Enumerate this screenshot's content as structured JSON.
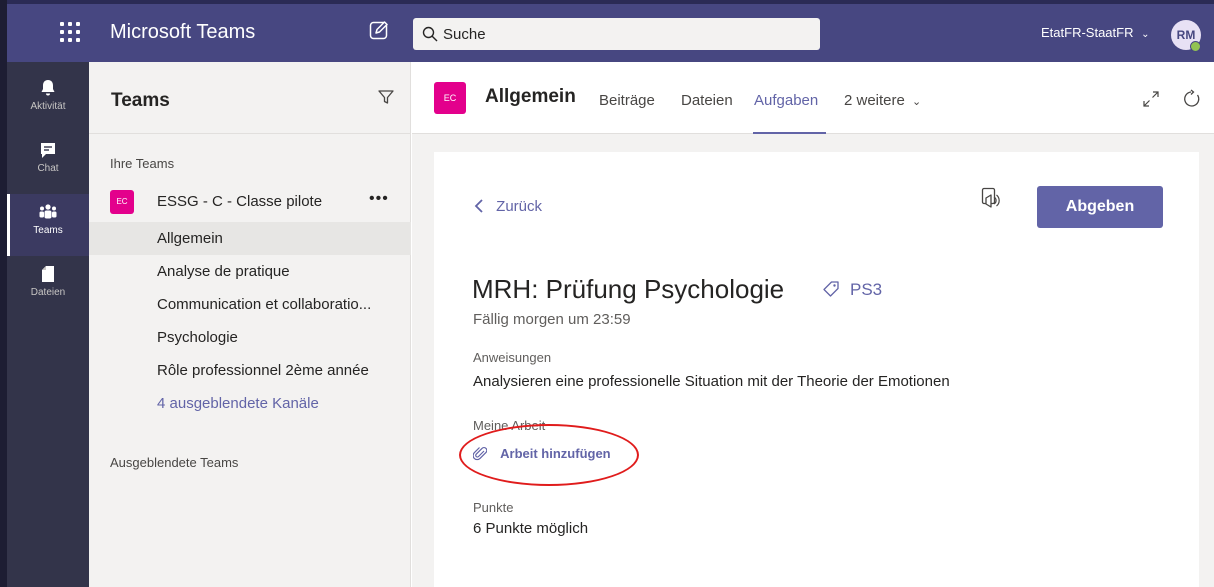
{
  "app": {
    "title": "Microsoft Teams",
    "org_switcher": "EtatFR-StaatFR",
    "user_initials": "RM",
    "accent_color": "#6264a7",
    "topbar_color": "#474781",
    "rail_color": "#33344a",
    "team_avatar_color": "#e3008c",
    "presence_color": "#92c353"
  },
  "search": {
    "placeholder": "Suche"
  },
  "rail": {
    "items": [
      {
        "label": "Aktivität",
        "icon": "bell-icon"
      },
      {
        "label": "Chat",
        "icon": "chat-icon"
      },
      {
        "label": "Teams",
        "icon": "teams-icon",
        "active": true
      },
      {
        "label": "Dateien",
        "icon": "files-icon"
      }
    ]
  },
  "panel": {
    "title": "Teams",
    "section_label": "Ihre Teams",
    "team": {
      "initials": "EC",
      "name": "ESSG - C - Classe pilote",
      "more": "•••"
    },
    "channels": [
      "Allgemein",
      "Analyse de pratique",
      "Communication et collaboratio...",
      "Psychologie",
      "Rôle professionnel 2ème année"
    ],
    "hidden_channels": "4 ausgeblendete Kanäle",
    "hidden_teams": "Ausgeblendete Teams"
  },
  "channel_header": {
    "initials": "EC",
    "title": "Allgemein",
    "tabs": [
      "Beiträge",
      "Dateien",
      "Aufgaben",
      "2 weitere"
    ],
    "active_tab": "Aufgaben"
  },
  "assignment": {
    "back_label": "Zurück",
    "submit_label": "Abgeben",
    "title": "MRH: Prüfung Psychologie",
    "tag": "PS3",
    "due": "Fällig morgen um 23:59",
    "instructions_label": "Anweisungen",
    "instructions": "Analysieren eine professionelle Situation mit der Theorie der Emotionen",
    "my_work_label": "Meine Arbeit",
    "add_work": "Arbeit hinzufügen",
    "points_label": "Punkte",
    "points": "6 Punkte möglich"
  }
}
